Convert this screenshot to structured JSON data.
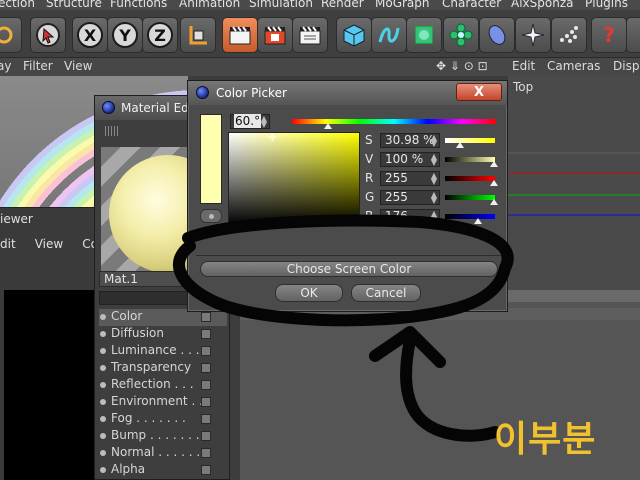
{
  "menubar": {
    "items": [
      "ection",
      "Structure",
      "Functions",
      "Animation",
      "Simulation",
      "Render",
      "MoGraph",
      "Character",
      "AixSponza",
      "Plugins"
    ]
  },
  "toolbar": {
    "axis_x": "X",
    "axis_y": "Y",
    "axis_z": "Z",
    "help_glyph": "?"
  },
  "secondary_menu": {
    "left_items": [
      "ay",
      "Filter",
      "View"
    ],
    "right_items": [
      "Edit",
      "Cameras",
      "Displ"
    ]
  },
  "viewport": {
    "view_label": "Top"
  },
  "picture_viewer": {
    "title": "iewer",
    "menu": [
      "dit",
      "View",
      "Com"
    ]
  },
  "material_editor": {
    "title": "Material Edi",
    "material_name": "Mat.1",
    "channels": [
      "Color",
      "Diffusion",
      "Luminance . . .",
      "Transparency",
      "Reflection . . .",
      "Environment . .",
      "Fog . . . . . . .",
      "Bump . . . . . . .",
      "Normal . . . . . .",
      "Alpha"
    ],
    "selected_channel": "Color"
  },
  "color_picker": {
    "title": "Color Picker",
    "close_label": "X",
    "hue_value": "60.°",
    "swatch_color": "#ffffb0",
    "fields": [
      {
        "label": "S",
        "value": "30.98 %"
      },
      {
        "label": "V",
        "value": "100 %"
      },
      {
        "label": "R",
        "value": "255"
      },
      {
        "label": "G",
        "value": "255"
      },
      {
        "label": "B",
        "value": "176"
      }
    ],
    "choose_screen_label": "Choose Screen Color",
    "ok_label": "OK",
    "cancel_label": "Cancel"
  },
  "annotation": {
    "text": "이부분"
  }
}
